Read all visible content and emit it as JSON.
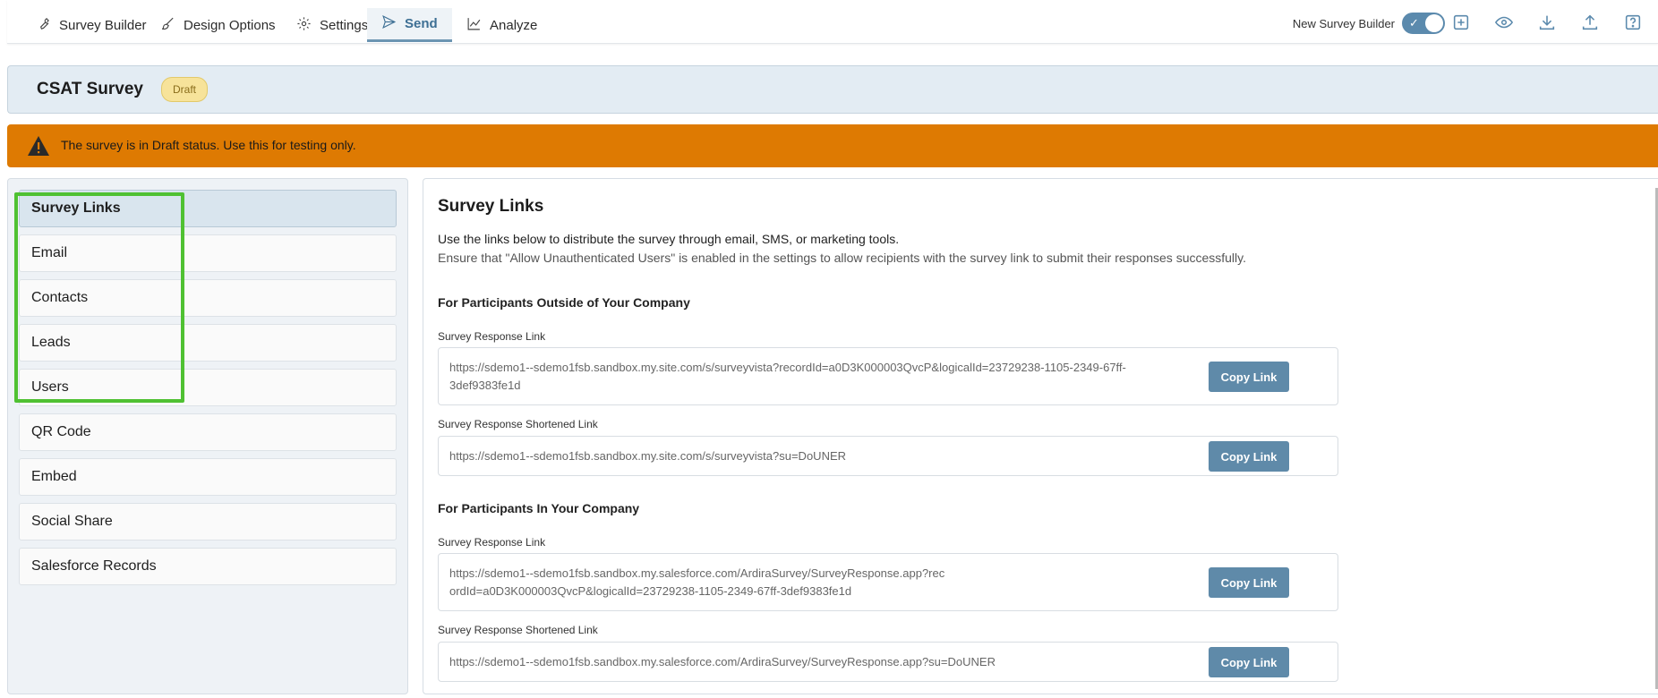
{
  "nav": {
    "tabs": [
      {
        "label": "Survey Builder",
        "icon": "wrench-icon"
      },
      {
        "label": "Design Options",
        "icon": "brush-icon"
      },
      {
        "label": "Settings",
        "icon": "gear-icon"
      },
      {
        "label": "Send",
        "icon": "send-icon",
        "active": true
      },
      {
        "label": "Analyze",
        "icon": "chart-icon"
      }
    ],
    "new_builder_label": "New Survey Builder",
    "toggle_on": true,
    "icons": [
      "plus-square-icon",
      "eye-icon",
      "download-icon",
      "upload-icon",
      "help-icon"
    ]
  },
  "survey": {
    "title": "CSAT Survey",
    "status": "Draft"
  },
  "warning": {
    "text": "The survey is in Draft status. Use this for testing only."
  },
  "sidebar": {
    "items": [
      {
        "label": "Survey Links",
        "active": true
      },
      {
        "label": "Email"
      },
      {
        "label": "Contacts"
      },
      {
        "label": "Leads"
      },
      {
        "label": "Users"
      },
      {
        "label": "QR Code"
      },
      {
        "label": "Embed"
      },
      {
        "label": "Social Share"
      },
      {
        "label": "Salesforce Records"
      }
    ]
  },
  "main": {
    "title": "Survey Links",
    "desc1": "Use the links below to distribute the survey through email, SMS, or marketing tools.",
    "desc2": "Ensure that \"Allow Unauthenticated Users\" is enabled in the settings to allow recipients with the survey link to submit their responses successfully.",
    "outside": {
      "heading": "For Participants Outside of Your Company",
      "response_label": "Survey Response Link",
      "response_url": "https://sdemo1--sdemo1fsb.sandbox.my.site.com/s/surveyvista?recordId=a0D3K000003QvcP&logicalId=23729238-1105-2349-67ff-3def9383fe1d",
      "short_label": "Survey Response Shortened Link",
      "short_url": "https://sdemo1--sdemo1fsb.sandbox.my.site.com/s/surveyvista?su=DoUNER"
    },
    "inside": {
      "heading": "For Participants In Your Company",
      "response_label": "Survey Response Link",
      "response_url": "https://sdemo1--sdemo1fsb.sandbox.my.salesforce.com/ArdiraSurvey/SurveyResponse.app?recordId=a0D3K000003QvcP&logicalId=23729238-1105-2349-67ff-3def9383fe1d",
      "short_label": "Survey Response Shortened Link",
      "short_url": "https://sdemo1--sdemo1fsb.sandbox.my.salesforce.com/ArdiraSurvey/SurveyResponse.app?su=DoUNER"
    },
    "copy_label": "Copy Link"
  },
  "colors": {
    "accent": "#5f8aa9",
    "warning_bg": "#de7a02",
    "highlight": "#4fc132",
    "badge_bg": "#f7e39a"
  }
}
